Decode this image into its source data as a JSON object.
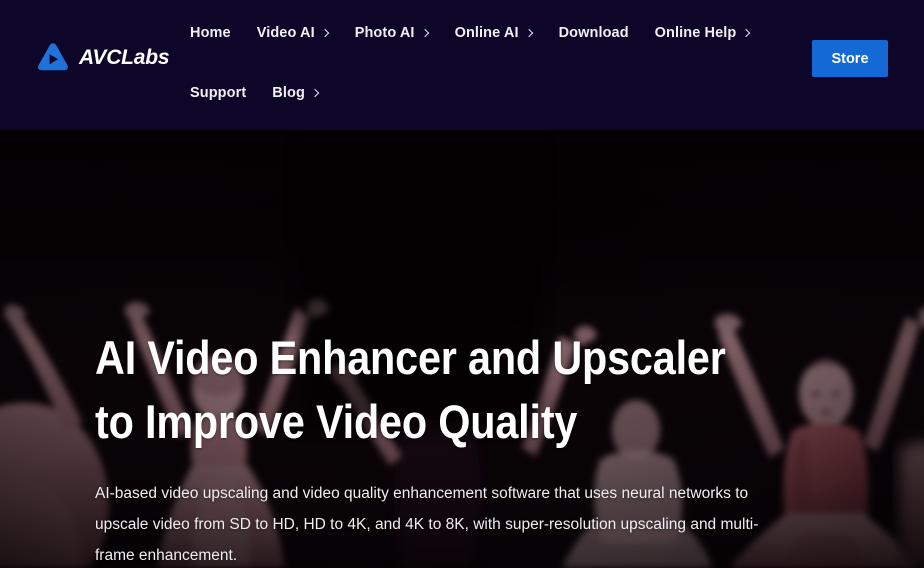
{
  "brand": {
    "name": "AVCLabs",
    "logo_icon": "play-triangle-logo-icon",
    "logo_color": "#1f72d8"
  },
  "header": {
    "background_color": "#0d0628",
    "nav": [
      {
        "label": "Home",
        "has_caret": false
      },
      {
        "label": "Video AI",
        "has_caret": true
      },
      {
        "label": "Photo AI",
        "has_caret": true
      },
      {
        "label": "Online AI",
        "has_caret": true
      },
      {
        "label": "Download",
        "has_caret": false
      },
      {
        "label": "Online Help",
        "has_caret": true
      },
      {
        "label": "Support",
        "has_caret": false
      },
      {
        "label": "Blog",
        "has_caret": true
      }
    ],
    "store_button": {
      "label": "Store",
      "color": "#1569d6"
    }
  },
  "hero": {
    "title": "AI Video Enhancer and Upscaler\nto Improve Video Quality",
    "subtitle": "AI-based video upscaling and video quality enhancement software that uses neural networks to upscale video from SD to HD, HD to 4K, and 4K to 8K, with super-resolution upscaling and multi-frame enhancement.",
    "background_image_alt": "ballet-dancers-stage-photo",
    "background_colors": {
      "stage_dark": "#0a0508",
      "tutu_rose": "#c9959c",
      "skin_rose": "#b9858c",
      "dress_red": "#b25b60"
    }
  }
}
